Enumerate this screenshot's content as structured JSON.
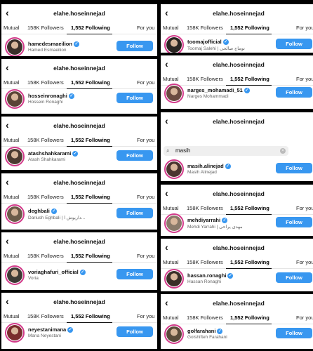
{
  "colors": {
    "accent": "#3897f0",
    "ring": "#d23a8a"
  },
  "screens": [
    {
      "username": "elahe.hoseinnejad",
      "tabs": [
        "Mutual",
        "158K Followers",
        "1,552 Following",
        "For you"
      ],
      "search": "",
      "handle": "hamedesmaeilion",
      "fullname": "Hamed Esmaeilion",
      "button": "Follow"
    },
    {
      "username": "elahe.hoseinnejad",
      "tabs": [
        "Mutual",
        "158K Followers",
        "1,552 Following",
        "For you"
      ],
      "search": "",
      "handle": "hosseinronaghi",
      "fullname": "Hossein Ronaghi",
      "button": "Follow"
    },
    {
      "username": "elahe.hoseinnejad",
      "tabs": [
        "Mutual",
        "158K Followers",
        "1,552 Following",
        "For you"
      ],
      "search": "",
      "handle": "atashshahkarami",
      "fullname": "Atash Shahkarami",
      "button": "Follow"
    },
    {
      "username": "elahe.hoseinnejad",
      "tabs": [
        "Mutual",
        "158K Followers",
        "1,552 Following",
        "For you"
      ],
      "search": "",
      "handle": "deghbali",
      "fullname": "Dariush Eghbali | داریوش ا...",
      "button": "Follow"
    },
    {
      "username": "elahe.hoseinnejad",
      "tabs": [
        "Mutual",
        "158K Followers",
        "1,552 Following",
        "For you"
      ],
      "search": "",
      "handle": "voriaghafuri_official",
      "fullname": "Voria",
      "button": "Follow"
    },
    {
      "username": "elahe.hoseinnejad",
      "tabs": [
        "Mutual",
        "158K Followers",
        "1,552 Following",
        "For you"
      ],
      "search": "",
      "handle": "neyestanimana",
      "fullname": "Mana Neyestani",
      "button": "Follow"
    },
    {
      "username": "elahe.hoseinnejad",
      "tabs": [
        "Mutual",
        "158K Followers",
        "1,552 Following",
        "For you"
      ],
      "search": "",
      "handle": "toomajofficial",
      "fullname": "Toomaj Salehi | توماج صالحی",
      "button": "Follow"
    },
    {
      "username": "elahe.hoseinnejad",
      "tabs": [
        "Mutual",
        "158K Followers",
        "1,552 Following",
        "For you"
      ],
      "search": "",
      "handle": "narges_mohamadi_51",
      "fullname": "Narges Mohammadi",
      "button": "Follow"
    },
    {
      "username": "elahe.hoseinnejad",
      "tabs": [],
      "search": "masih",
      "handle": "masih.alinejad",
      "fullname": "Masih Alinejad",
      "button": "Follow"
    },
    {
      "username": "elahe.hoseinnejad",
      "tabs": [
        "Mutual",
        "158K Followers",
        "1,552 Following",
        "For you"
      ],
      "search": "",
      "handle": "mehdiyarrahi",
      "fullname": "Mehdi Yarrahi | مهدی یراحی",
      "button": "Follow"
    },
    {
      "username": "elahe.hoseinnejad",
      "tabs": [
        "Mutual",
        "158K Followers",
        "1,552 Following",
        "For you"
      ],
      "search": "",
      "handle": "hassan.ronaghi",
      "fullname": "Hassan Ronaghi",
      "button": "Follow"
    },
    {
      "username": "elahe.hoseinnejad",
      "tabs": [
        "Mutual",
        "158K Followers",
        "1,552 Following",
        "For you"
      ],
      "search": "",
      "handle": "golfarahani",
      "fullname": "Golshifteh Farahani",
      "button": "Follow"
    }
  ]
}
